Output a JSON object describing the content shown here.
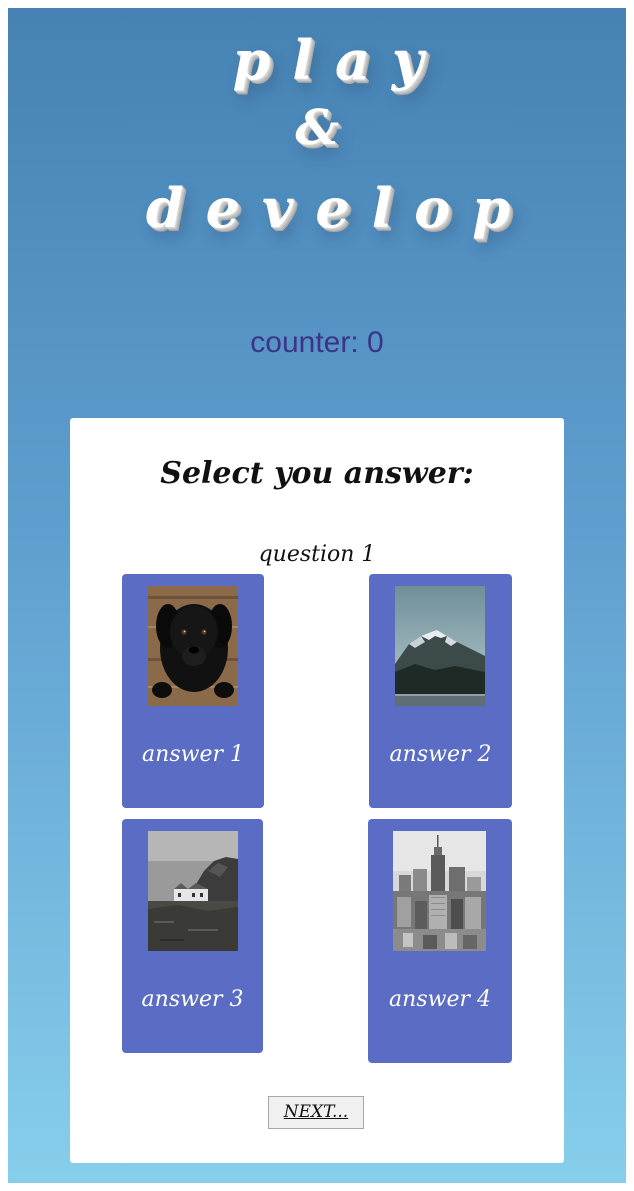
{
  "logo": {
    "line1": "play",
    "line2": "&",
    "line3": "develop"
  },
  "counter": {
    "label": "counter:",
    "value": "0"
  },
  "quiz": {
    "title": "Select you answer:",
    "question": "question 1",
    "answers": [
      {
        "label": "answer 1",
        "image": "black-puppy-photo"
      },
      {
        "label": "answer 2",
        "image": "snowy-mountain-photo"
      },
      {
        "label": "answer 3",
        "image": "coastal-cottage-photo"
      },
      {
        "label": "answer 4",
        "image": "city-skyline-photo"
      }
    ],
    "next_label": "NEXT..."
  },
  "colors": {
    "background_top": "#4682b4",
    "background_bottom": "#87ceeb",
    "counter_text": "#3c3489",
    "answer_tile": "#5a6cc4"
  }
}
